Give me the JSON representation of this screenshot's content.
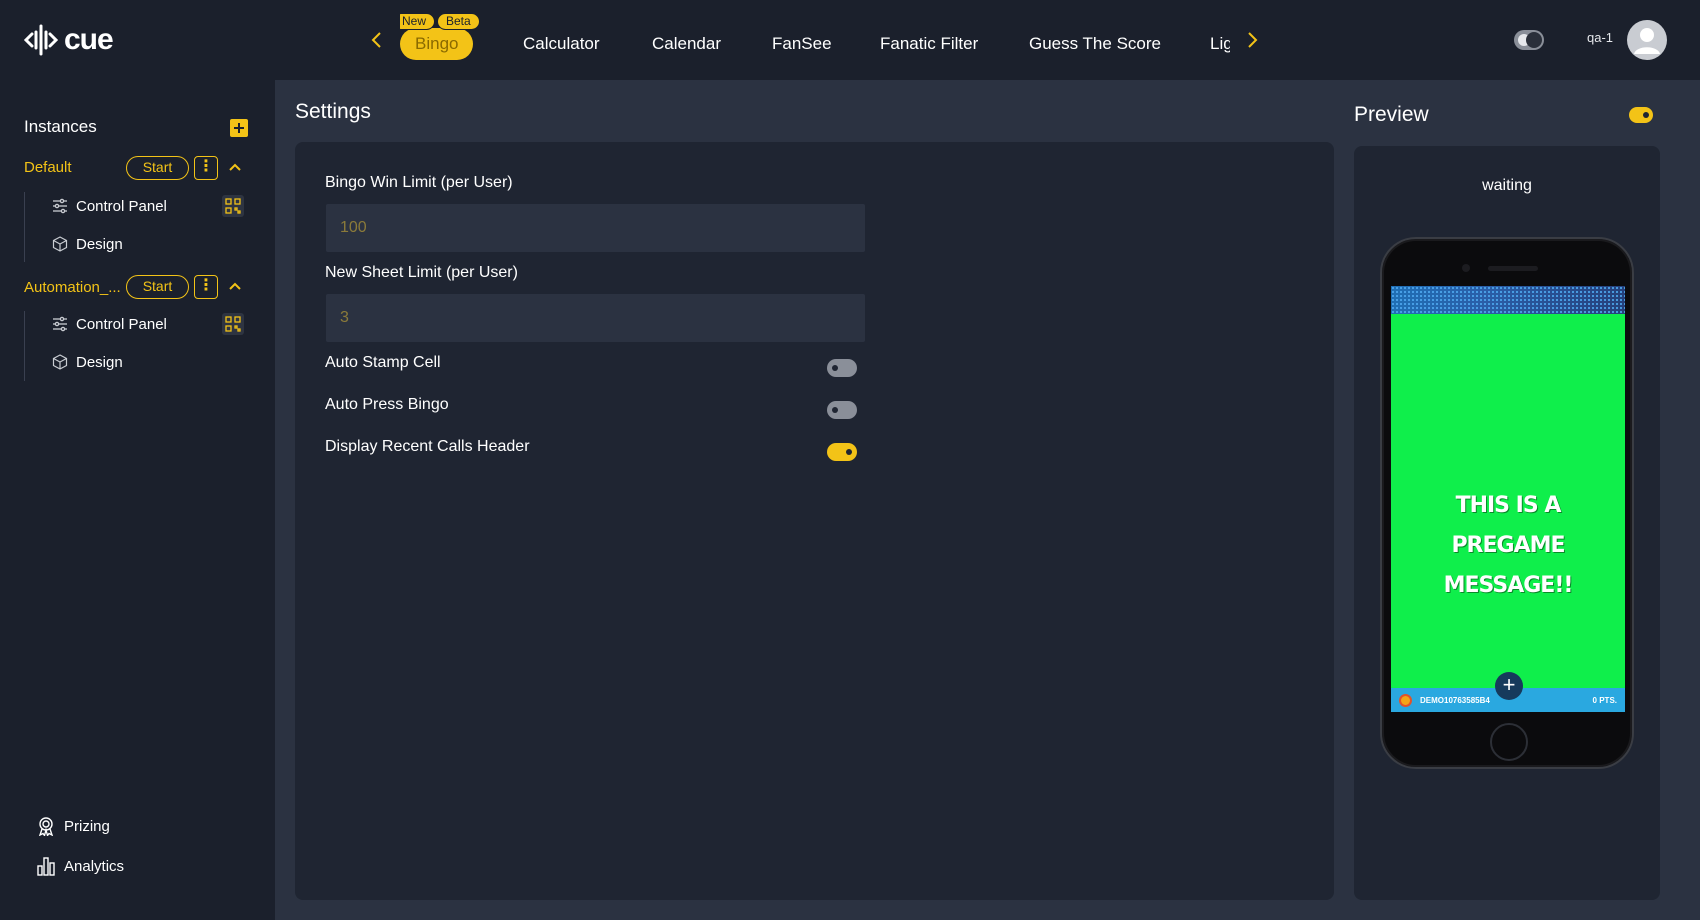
{
  "header": {
    "logo_text": "cue",
    "tabs": [
      {
        "label": "Bingo",
        "badges": [
          "New",
          "Beta"
        ],
        "active": true
      },
      {
        "label": "Calculator"
      },
      {
        "label": "Calendar"
      },
      {
        "label": "FanSee"
      },
      {
        "label": "Fanatic Filter"
      },
      {
        "label": "Guess The Score"
      },
      {
        "label": "Lig"
      }
    ],
    "username": "qa-1"
  },
  "sidebar": {
    "title": "Instances",
    "instances": [
      {
        "name": "Default",
        "start_label": "Start",
        "children": [
          {
            "label": "Control Panel"
          },
          {
            "label": "Design"
          }
        ]
      },
      {
        "name": "Automation_...",
        "start_label": "Start",
        "children": [
          {
            "label": "Control Panel"
          },
          {
            "label": "Design"
          }
        ]
      }
    ],
    "bottom": [
      {
        "label": "Prizing"
      },
      {
        "label": "Analytics"
      }
    ]
  },
  "settings": {
    "title": "Settings",
    "fields": [
      {
        "label": "Bingo Win Limit (per User)",
        "value": "100"
      },
      {
        "label": "New Sheet Limit (per User)",
        "value": "3"
      }
    ],
    "toggles": [
      {
        "label": "Auto Stamp Cell",
        "on": false
      },
      {
        "label": "Auto Press Bingo",
        "on": false
      },
      {
        "label": "Display Recent Calls Header",
        "on": true
      }
    ]
  },
  "preview": {
    "title": "Preview",
    "enabled": true,
    "status": "waiting",
    "message": "This is a pregame message!!",
    "footer_user": "DEMO10763585B4",
    "footer_pts": "0 PTS."
  },
  "colors": {
    "accent": "#f3c317",
    "background": "#1b202c",
    "panel": "#1f2532",
    "main": "#2b3241",
    "screen_green": "#0fef4b"
  }
}
